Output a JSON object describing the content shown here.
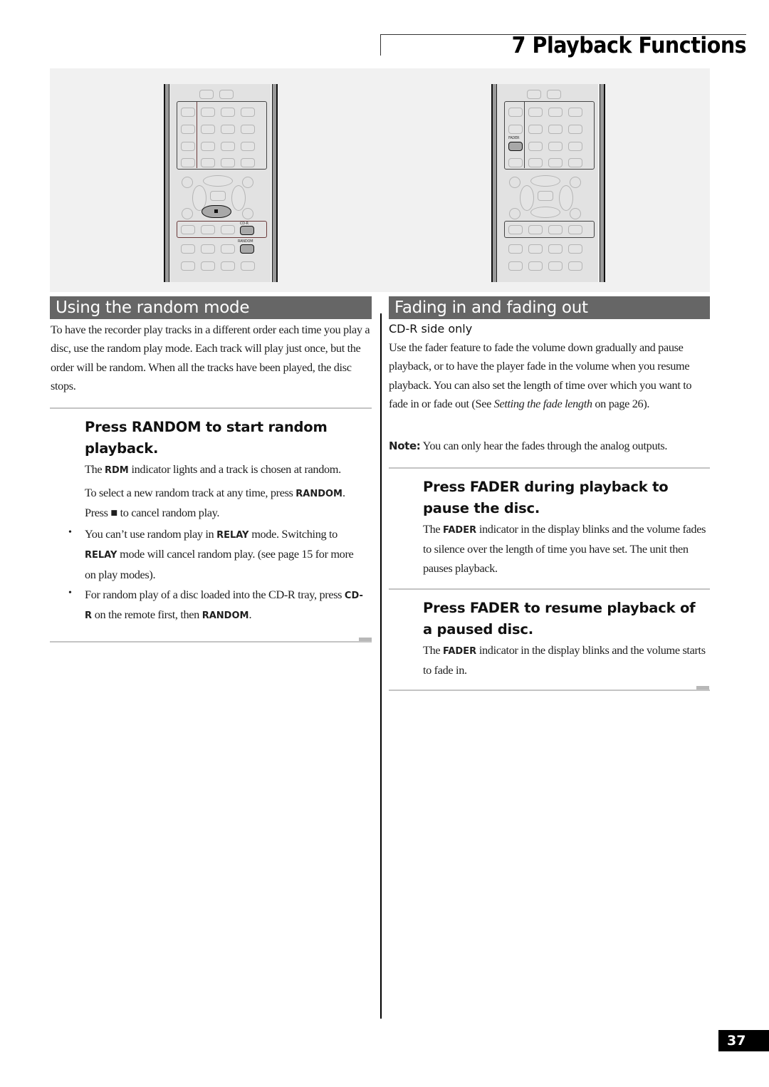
{
  "header": {
    "chapter_title": "7 Playback Functions"
  },
  "figure": {
    "left_remote": {
      "highlighted_buttons": [
        "stop",
        "cd-r",
        "random"
      ],
      "labels": {
        "cdr": "CD-R",
        "random": "RANDOM",
        "stop_symbol": "■"
      }
    },
    "right_remote": {
      "highlighted_buttons": [
        "fader"
      ],
      "labels": {
        "fader": "FADER"
      }
    }
  },
  "random_section": {
    "heading": "Using the random mode",
    "intro": "To have the recorder play tracks in a different order each time you play a disc, use the random play mode. Each track will play just once, but the order will be random. When all the tracks have been played, the disc stops.",
    "step1": {
      "title": "Press RANDOM to start random playback.",
      "line1_pre": "The ",
      "line1_kw": "RDM",
      "line1_post": " indicator lights and a track is chosen at random.",
      "line2_pre": "To select a new random track at any time, press ",
      "line2_kw": "RANDOM",
      "line2_post": ".",
      "line3_pre": "Press ",
      "line3_symbol": "■",
      "line3_post": " to cancel random play."
    },
    "bullets": [
      {
        "pre": "You can’t use random play in ",
        "kw1": "RELAY",
        "mid": " mode. Switching to ",
        "kw2": "RELAY",
        "post": " mode will cancel random play. (see page 15 for more on play modes)."
      },
      {
        "pre": "For random play of a disc loaded into the CD-R tray, press ",
        "kw1": "CD-R",
        "mid": " on the remote first, then ",
        "kw2": "RANDOM",
        "post": "."
      }
    ],
    "bullet_char": "•"
  },
  "fading_section": {
    "heading": "Fading in and fading out",
    "subheading": "CD-R side only",
    "intro_pre": "Use the fader feature to fade the volume down gradually and pause playback, or to have the player fade in the volume when you resume playback. You can also set the length of time over which you want to fade in or fade out (See ",
    "intro_italic": "Setting the fade length",
    "intro_post": " on page 26).",
    "note_label": "Note:",
    "note_text": " You can only hear the fades through the analog outputs.",
    "step1": {
      "title": "Press FADER during playback to pause the disc.",
      "pre": "The ",
      "kw": "FADER",
      "post": " indicator in the display blinks and the volume fades to silence over the length of time you have set. The unit then pauses playback."
    },
    "step2": {
      "title": "Press FADER to resume playback of a paused disc.",
      "pre": "The ",
      "kw": "FADER",
      "post": " indicator in the display blinks and the volume starts to fade in."
    }
  },
  "footer": {
    "page_number": "37"
  }
}
